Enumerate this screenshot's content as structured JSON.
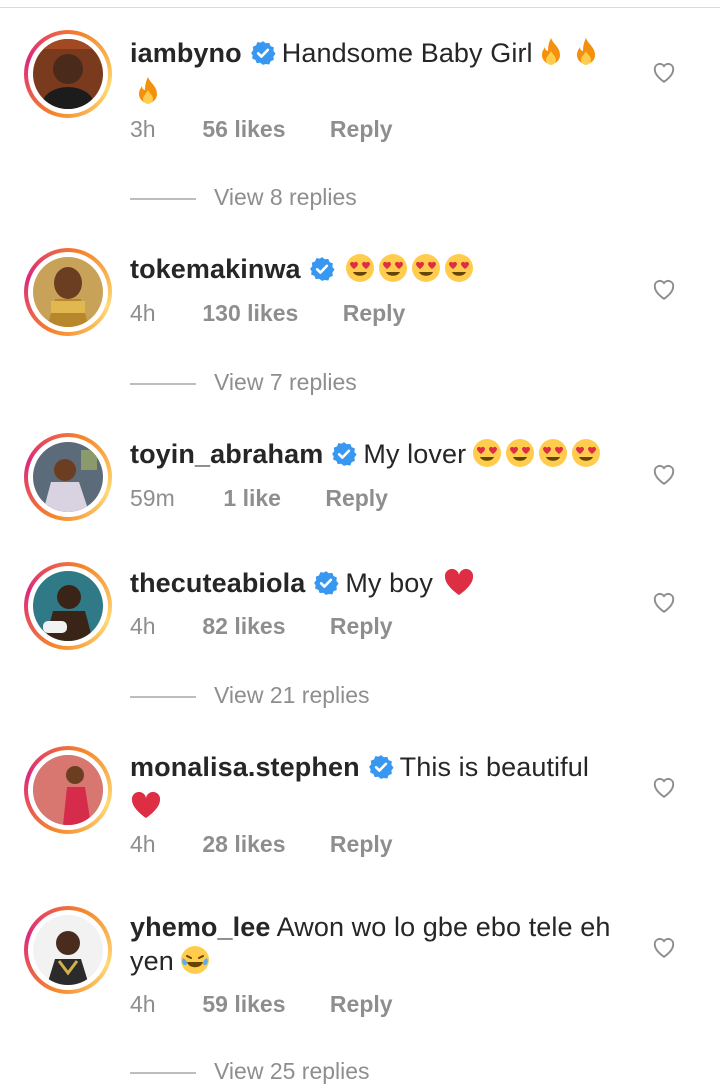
{
  "comments": [
    {
      "username": "iambyno",
      "verified": true,
      "text": "Handsome Baby Girl",
      "emoji_after": [
        "fire",
        "fire",
        "fire"
      ],
      "time": "3h",
      "likes": "56 likes",
      "reply": "Reply",
      "view_replies": "View 8 replies"
    },
    {
      "username": "tokemakinwa",
      "verified": true,
      "text": "",
      "emoji_after": [
        "heart-eyes",
        "heart-eyes",
        "heart-eyes",
        "heart-eyes"
      ],
      "time": "4h",
      "likes": "130 likes",
      "reply": "Reply",
      "view_replies": "View 7 replies"
    },
    {
      "username": "toyin_abraham",
      "verified": true,
      "text": "My lover",
      "emoji_after": [
        "heart-eyes",
        "heart-eyes",
        "heart-eyes",
        "heart-eyes"
      ],
      "time": "59m",
      "likes": "1 like",
      "reply": "Reply",
      "view_replies": ""
    },
    {
      "username": "thecuteabiola",
      "verified": true,
      "text": "My boy",
      "emoji_after": [
        "red-heart"
      ],
      "time": "4h",
      "likes": "82 likes",
      "reply": "Reply",
      "view_replies": "View 21 replies"
    },
    {
      "username": "monalisa.stephen",
      "verified": true,
      "text": "This is beautiful",
      "emoji_after": [
        "red-heart"
      ],
      "time": "4h",
      "likes": "28 likes",
      "reply": "Reply",
      "view_replies": ""
    },
    {
      "username": "yhemo_lee",
      "verified": false,
      "text": "Awon wo lo gbe ebo tele eh yen",
      "emoji_after": [
        "tears-of-joy"
      ],
      "time": "4h",
      "likes": "59 likes",
      "reply": "Reply",
      "view_replies": "View 25 replies"
    }
  ],
  "colors": {
    "verified_blue": "#3897f0",
    "meta_gray": "#8e8e8e",
    "text": "#262626"
  }
}
